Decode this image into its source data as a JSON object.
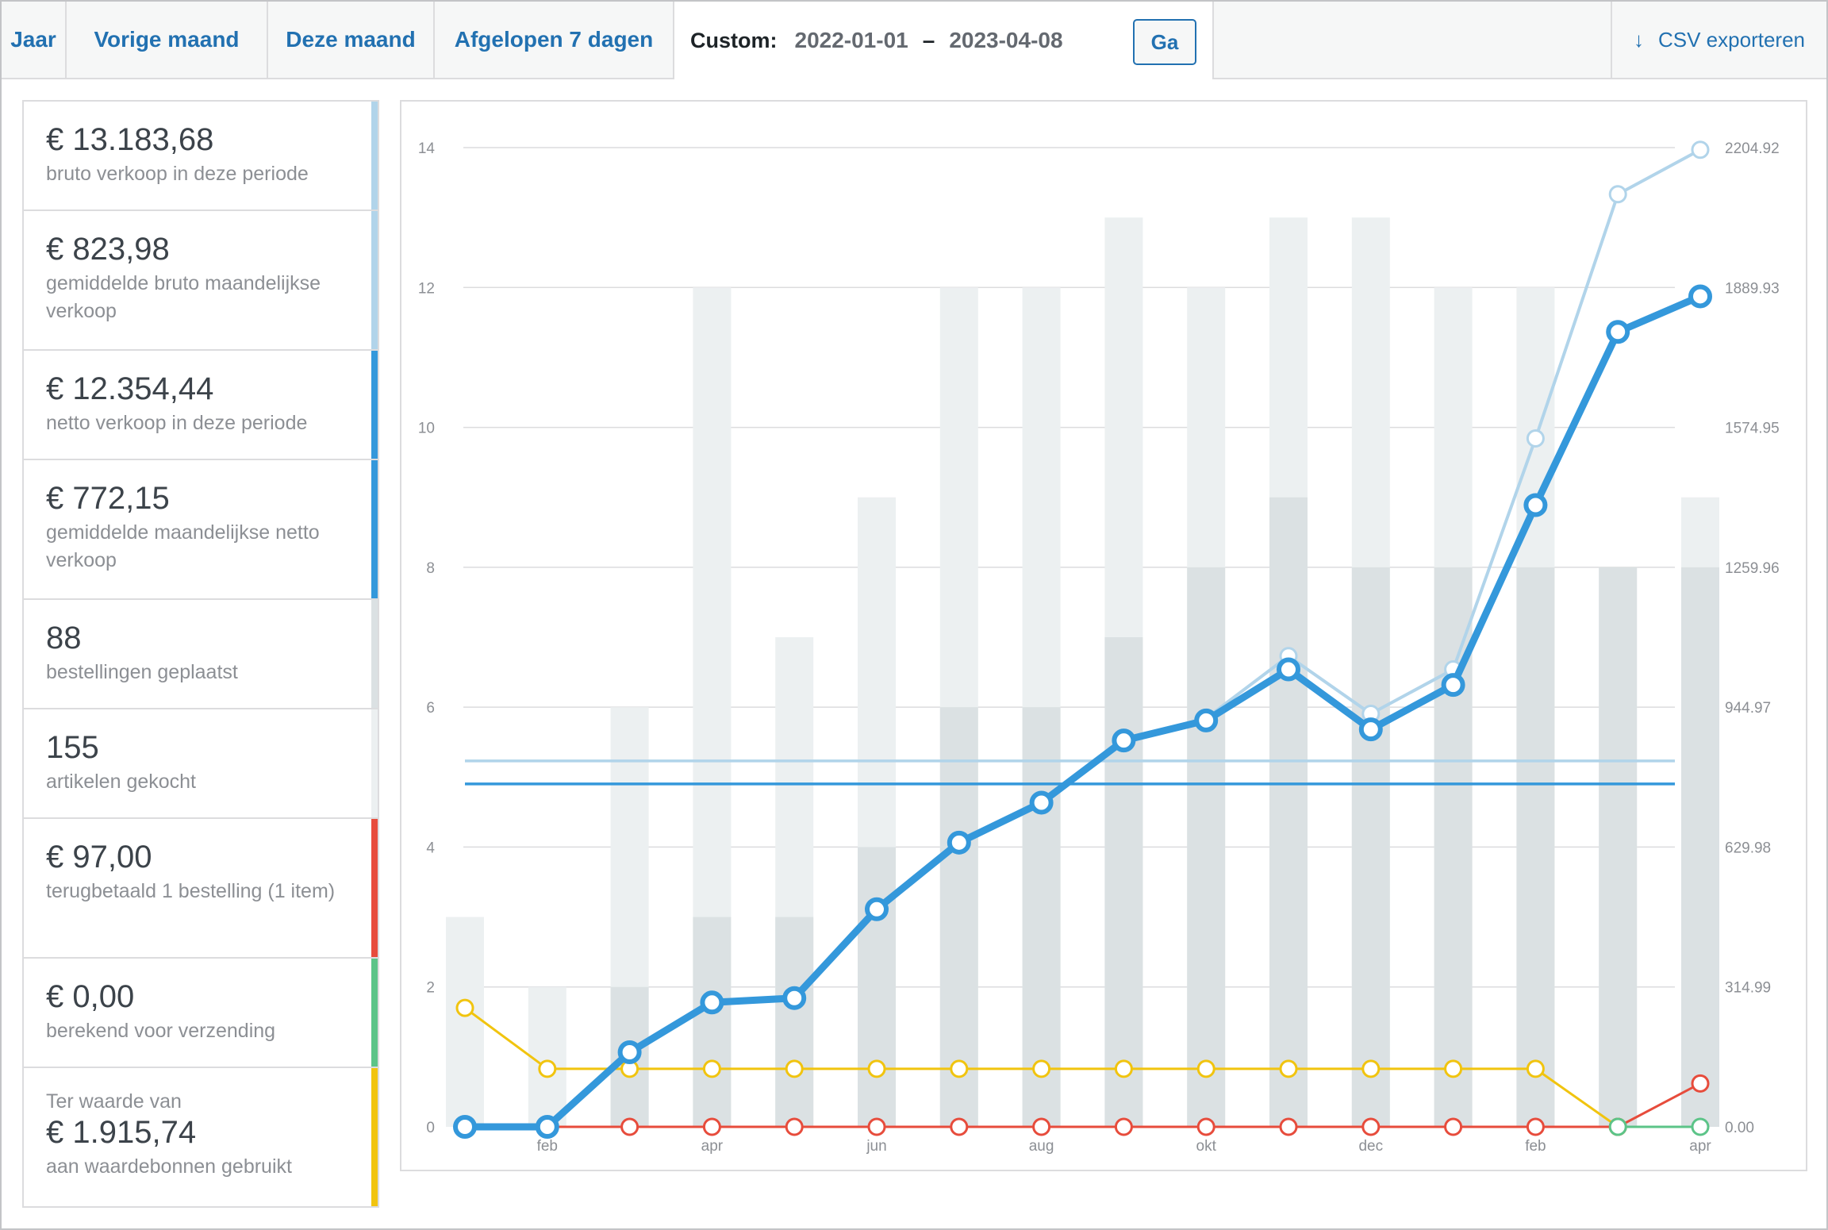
{
  "tabs": {
    "year": "Jaar",
    "last_month": "Vorige maand",
    "this_month": "Deze maand",
    "last_7_days": "Afgelopen 7 dagen",
    "custom_label": "Custom:",
    "date_from": "2022-01-01",
    "date_separator": "–",
    "date_to": "2023-04-08",
    "go_button": "Ga",
    "export_label": "CSV exporteren",
    "export_icon": "download-arrow-icon"
  },
  "legend": [
    {
      "amount": "€ 13.183,68",
      "desc": "bruto verkoop in deze periode",
      "color": "#b1d4ea"
    },
    {
      "amount": "€ 823,98",
      "desc": "gemiddelde bruto maandelijkse verkoop",
      "color": "#b1d4ea"
    },
    {
      "amount": "€ 12.354,44",
      "desc": "netto verkoop in deze periode",
      "color": "#3498db"
    },
    {
      "amount": "€ 772,15",
      "desc": "gemiddelde maandelijkse netto verkoop",
      "color": "#3498db"
    },
    {
      "amount": "88",
      "desc": "bestellingen geplaatst",
      "color": "#dbe1e3"
    },
    {
      "amount": "155",
      "desc": "artikelen gekocht",
      "color": "#ecf0f1"
    },
    {
      "amount": "€ 97,00",
      "desc": "terugbetaald 1 bestelling (1 item)",
      "color": "#e74c3c"
    },
    {
      "amount": "€ 0,00",
      "desc": "berekend voor verzending",
      "color": "#5cc488"
    },
    {
      "pre": "Ter waarde van",
      "amount": "€ 1.915,74",
      "desc": "aan waardebonnen gebruikt",
      "color": "#f1c40f"
    }
  ],
  "chart_data": {
    "type": "bar+line",
    "x_tick_labels": [
      "",
      "feb",
      "",
      "apr",
      "",
      "jun",
      "",
      "aug",
      "",
      "okt",
      "",
      "dec",
      "",
      "feb",
      "",
      "apr"
    ],
    "left_axis": {
      "ylim": [
        0,
        14
      ],
      "ticks": [
        0,
        2,
        4,
        6,
        8,
        10,
        12,
        14
      ]
    },
    "right_axis": {
      "ylim": [
        0,
        2204.92
      ],
      "ticks": [
        "0.00",
        "314.99",
        "629.98",
        "944.97",
        "1259.96",
        "1574.95",
        "1889.93",
        "2204.92"
      ]
    },
    "bars": [
      {
        "name": "artikelen gekocht",
        "color": "#ecf0f1",
        "values": [
          3,
          2,
          6,
          12,
          7,
          9,
          12,
          12,
          13,
          12,
          13,
          13,
          12,
          12,
          8,
          9
        ]
      },
      {
        "name": "bestellingen geplaatst",
        "color": "#dbe1e3",
        "values": [
          0,
          0,
          2,
          3,
          3,
          4,
          6,
          6,
          7,
          8,
          9,
          8,
          8,
          8,
          8,
          8
        ]
      }
    ],
    "lines_left_axis": [
      {
        "name": "waardebonnen",
        "color": "#f1c40f",
        "values": [
          1.7,
          0.83,
          0.83,
          0.83,
          0.83,
          0.83,
          0.83,
          0.83,
          0.83,
          0.83,
          0.83,
          0.83,
          0.83,
          0.83,
          0,
          null
        ]
      },
      {
        "name": "terugbetaald",
        "color": "#e74c3c",
        "values": [
          0,
          0,
          0,
          0,
          0,
          0,
          0,
          0,
          0,
          0,
          0,
          0,
          0,
          0,
          0,
          0.62
        ]
      },
      {
        "name": "verzending",
        "color": "#5cc488",
        "values": [
          null,
          null,
          null,
          null,
          null,
          null,
          null,
          null,
          null,
          null,
          null,
          null,
          null,
          null,
          0,
          0
        ]
      }
    ],
    "lines_right_axis": [
      {
        "name": "bruto verkoop",
        "color": "#b1d4ea",
        "values": [
          0,
          0,
          168,
          280,
          290,
          490,
          640,
          730,
          870,
          920,
          1060,
          930,
          1030,
          1550,
          2100,
          2200
        ]
      },
      {
        "name": "netto verkoop",
        "color": "#3498db",
        "values": [
          0,
          0,
          168,
          280,
          290,
          490,
          640,
          730,
          870,
          915,
          1030,
          895,
          995,
          1400,
          1790,
          1870
        ]
      }
    ],
    "average_lines_right_axis": [
      {
        "name": "gemiddelde bruto",
        "color": "#b1d4ea",
        "value": 823.98
      },
      {
        "name": "gemiddelde netto",
        "color": "#3498db",
        "value": 772.15
      }
    ]
  }
}
